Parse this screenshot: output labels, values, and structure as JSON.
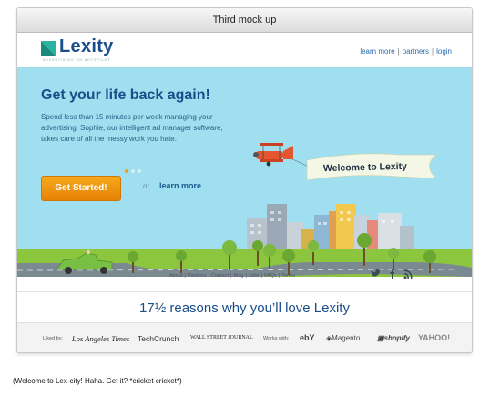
{
  "window": {
    "title": "Third mock up"
  },
  "brand": {
    "name": "Lexity",
    "tagline": "ADVERTISING ON AUTOPILOT"
  },
  "nav": {
    "items": [
      "learn more",
      "partners",
      "login"
    ]
  },
  "hero": {
    "headline": "Get your life back again!",
    "body": "Spend less than 15 minutes per week managing your advertising. Sophie, our intelligent ad manager software, takes care of all the messy work you hate.",
    "banner_text": "Welcome to Lexity",
    "cta_label": "Get Started!",
    "or_text": "or",
    "learn_more_label": "learn more",
    "slide_count": 3,
    "active_slide": 1
  },
  "footer": {
    "links": [
      "About",
      "Partners",
      "Contact",
      "Blog",
      "Jobs",
      "FAQs",
      "Terms"
    ]
  },
  "social": {
    "icons": [
      "twitter-icon",
      "facebook-icon",
      "rss-icon"
    ]
  },
  "reasons": {
    "text": "17½ reasons why you’ll love Lexity"
  },
  "press": {
    "liked_by_label": "Liked by:",
    "liked_by": [
      "Los Angeles Times",
      "TechCrunch",
      "WALL STREET JOURNAL"
    ],
    "works_with_label": "Works with:",
    "works_with": [
      "ebY",
      "Magento",
      "shopify",
      "YAHOO!"
    ]
  },
  "caption": "(Welcome to Lex-city! Haha. Get it? *cricket cricket*)",
  "colors": {
    "sky": "#9fdfef",
    "grass": "#8cc63f",
    "brand": "#1a4e8a",
    "cta": "#f39c1e"
  }
}
